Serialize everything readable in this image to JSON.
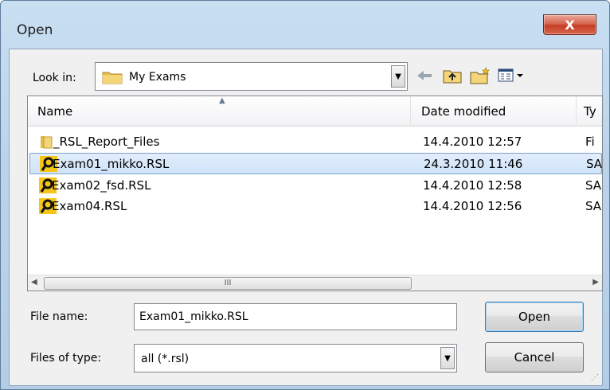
{
  "window": {
    "title": "Open",
    "close_glyph": "X"
  },
  "look_in": {
    "label": "Look in:",
    "value": "My Exams"
  },
  "toolbar": {
    "icons": [
      "back-arrow-icon",
      "up-folder-icon",
      "new-folder-icon",
      "view-menu-icon"
    ]
  },
  "list": {
    "columns": [
      "Name",
      "Date modified",
      "Ty"
    ],
    "rows": [
      {
        "name": "_RSL_Report_Files",
        "date": "14.4.2010 12:57",
        "type": "Fi",
        "icon": "folder-icon",
        "selected": false
      },
      {
        "name": "Exam01_mikko.RSL",
        "date": "24.3.2010 11:46",
        "type": "SA",
        "icon": "rsl-file-icon",
        "selected": true
      },
      {
        "name": "Exam02_fsd.RSL",
        "date": "14.4.2010 12:58",
        "type": "SA",
        "icon": "rsl-file-icon",
        "selected": false
      },
      {
        "name": "Exam04.RSL",
        "date": "14.4.2010 12:56",
        "type": "SA",
        "icon": "rsl-file-icon",
        "selected": false
      }
    ],
    "scroll_thumb_grip": "III"
  },
  "file_name": {
    "label": "File name:",
    "value": "Exam01_mikko.RSL"
  },
  "files_of_type": {
    "label": "Files of type:",
    "value": "all (*.rsl)"
  },
  "buttons": {
    "open": "Open",
    "cancel": "Cancel"
  },
  "colors": {
    "selection": "#cfe3fa",
    "selection_border": "#7da2ce",
    "frame": "#b9d1ea",
    "close": "#c53e24"
  }
}
